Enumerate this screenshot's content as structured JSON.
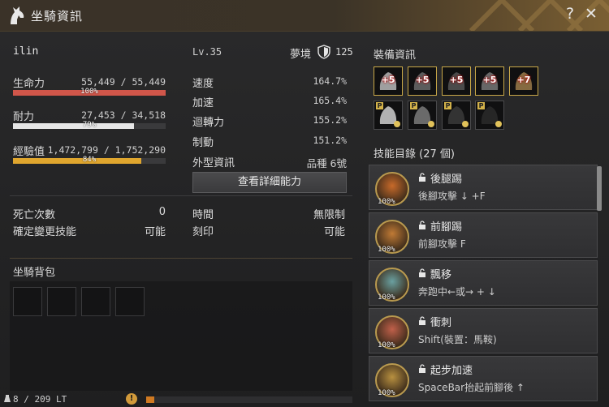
{
  "window": {
    "title": "坐騎資訊"
  },
  "horse": {
    "name": "ilin",
    "level": "Lv.35",
    "mount_type": "夢境",
    "tier_value": "125"
  },
  "bars": [
    {
      "label": "生命力",
      "value": "55,449 / 55,449",
      "pct_text": "100%",
      "fill_pct": 100,
      "color": "#d0564a"
    },
    {
      "label": "耐力",
      "value": "27,453 / 34,518",
      "pct_text": "79%",
      "fill_pct": 79,
      "color": "#e6e6e6"
    },
    {
      "label": "經驗值",
      "value": "1,472,799 / 1,752,290",
      "pct_text": "84%",
      "fill_pct": 84,
      "color": "#e0a62e"
    }
  ],
  "stats": [
    {
      "label": "速度",
      "value": "164.7%"
    },
    {
      "label": "加速",
      "value": "165.4%"
    },
    {
      "label": "迴轉力",
      "value": "155.2%"
    },
    {
      "label": "制動",
      "value": "151.2%"
    },
    {
      "label": "外型資訊",
      "value": "品種 6號"
    }
  ],
  "detail_button": "查看詳細能力",
  "info": [
    {
      "label": "死亡次數",
      "value": "0"
    },
    {
      "label": "確定變更技能",
      "value": "可能"
    },
    {
      "label": "時間",
      "value": "無限制"
    },
    {
      "label": "刻印",
      "value": "可能"
    }
  ],
  "bag": {
    "title": "坐騎背包",
    "weight": "8 / 209 LT",
    "weight_fill_pct": 4
  },
  "equipment": {
    "title": "裝備資訊",
    "items": [
      {
        "name": "horse-helmet-icon",
        "enh": "+5",
        "plain": false
      },
      {
        "name": "horse-armor-icon",
        "enh": "+5",
        "plain": false
      },
      {
        "name": "horse-saddle-icon",
        "enh": "+5",
        "plain": false
      },
      {
        "name": "horse-stirrups-icon",
        "enh": "+5",
        "plain": false
      },
      {
        "name": "horseshoe-icon",
        "enh": "+7",
        "plain": false
      },
      {
        "name": "horse-outfit-head-icon",
        "enh": "",
        "plain": true
      },
      {
        "name": "horse-outfit-armor-icon",
        "enh": "",
        "plain": true
      },
      {
        "name": "horse-outfit-saddle-icon",
        "enh": "",
        "plain": true
      },
      {
        "name": "horse-outfit-foot-icon",
        "enh": "",
        "plain": true
      }
    ]
  },
  "skills": {
    "title": "技能目錄 (27 個)",
    "items": [
      {
        "name": "後腿踢",
        "cmd": "後腳攻擊 ↓ +F",
        "pct": "100%",
        "color": "#c86a2a"
      },
      {
        "name": "前腳踢",
        "cmd": "前腳攻擊 F",
        "pct": "100%",
        "color": "#c07a35"
      },
      {
        "name": "飄移",
        "cmd": "奔跑中←或→ + ↓",
        "pct": "100%",
        "color": "#6aa0a0"
      },
      {
        "name": "衝刺",
        "cmd": "Shift(裝置：馬鞍)",
        "pct": "100%",
        "color": "#c0604a"
      },
      {
        "name": "起步加速",
        "cmd": "SpaceBar抬起前腳後 ↑",
        "pct": "100%",
        "color": "#b89040"
      }
    ]
  }
}
